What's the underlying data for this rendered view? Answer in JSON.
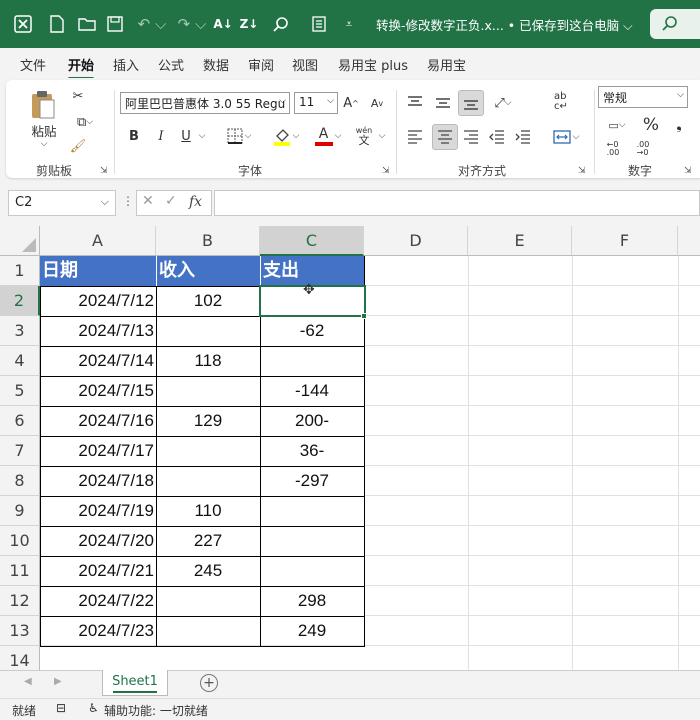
{
  "titlebar": {
    "title": "转换-修改数字正负.x... • 已保存到这台电脑",
    "chevron": "⌵",
    "search_icon": "search-icon"
  },
  "menu": [
    "文件",
    "开始",
    "插入",
    "公式",
    "数据",
    "审阅",
    "视图",
    "易用宝 plus",
    "易用宝"
  ],
  "ribbon": {
    "clipboard": {
      "paste": "粘贴",
      "label": "剪贴板"
    },
    "font": {
      "name": "阿里巴巴普惠体 3.0 55 Regu",
      "size": "11",
      "bold": "B",
      "italic": "I",
      "underline": "U",
      "label": "字体",
      "wen": "wén",
      "wen_char": "文"
    },
    "alignment": {
      "label": "对齐方式"
    },
    "number": {
      "format": "常规",
      "label": "数字",
      "percent": "%"
    }
  },
  "formula_bar": {
    "namebox": "C2",
    "fx": "fx",
    "formula": ""
  },
  "columns": [
    "A",
    "B",
    "C",
    "D",
    "E",
    "F"
  ],
  "rows": [
    "1",
    "2",
    "3",
    "4",
    "5",
    "6",
    "7",
    "8",
    "9",
    "10",
    "11",
    "12",
    "13",
    "14"
  ],
  "header_row": {
    "date": "日期",
    "income": "收入",
    "expense": "支出"
  },
  "data": [
    {
      "date": "2024/7/12",
      "income": "102",
      "expense": ""
    },
    {
      "date": "2024/7/13",
      "income": "",
      "expense": "-62"
    },
    {
      "date": "2024/7/14",
      "income": "118",
      "expense": ""
    },
    {
      "date": "2024/7/15",
      "income": "",
      "expense": "-144"
    },
    {
      "date": "2024/7/16",
      "income": "129",
      "expense": "200-"
    },
    {
      "date": "2024/7/17",
      "income": "",
      "expense": "36-"
    },
    {
      "date": "2024/7/18",
      "income": "",
      "expense": "-297"
    },
    {
      "date": "2024/7/19",
      "income": "110",
      "expense": ""
    },
    {
      "date": "2024/7/20",
      "income": "227",
      "expense": ""
    },
    {
      "date": "2024/7/21",
      "income": "245",
      "expense": ""
    },
    {
      "date": "2024/7/22",
      "income": "",
      "expense": "298"
    },
    {
      "date": "2024/7/23",
      "income": "",
      "expense": "249"
    }
  ],
  "sheet_tab": "Sheet1",
  "status": {
    "ready": "就绪",
    "accessibility": "辅助功能: 一切就绪"
  },
  "colors": {
    "green": "#217346",
    "header_blue": "#4472c4"
  }
}
